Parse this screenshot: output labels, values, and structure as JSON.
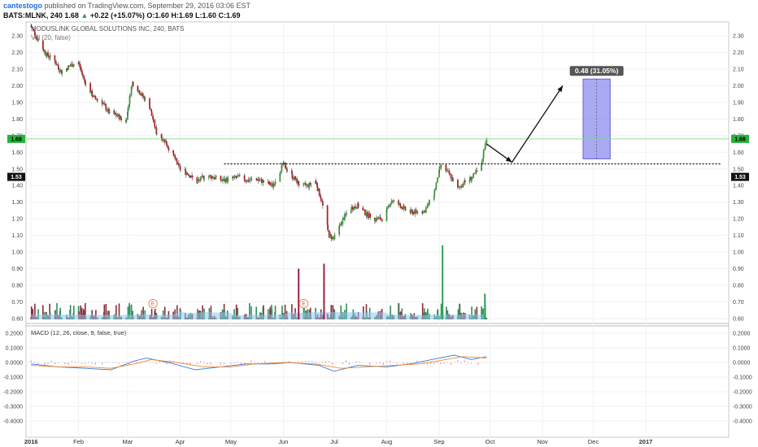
{
  "header": {
    "author": "cantestogo",
    "published": "published on TradingView.com, September 29, 2016 03:06 EST",
    "symbol": "BATS:MLNK, 240",
    "last": "1.68",
    "up_arrow": "▲",
    "change": "+0.22 (+15.07%)",
    "ohlc": "O:1.60 H:1.69 L:1.60 C:1.69"
  },
  "chart_data": [
    {
      "type": "candlestick",
      "title": "MODUSLINK GLOBAL SOLUTIONS INC, 240, BATS",
      "volume_label": "Vol (20, false)",
      "x_tick_labels": [
        "2016",
        "Feb",
        "Mar",
        "Apr",
        "May",
        "Jun",
        "Jul",
        "Aug",
        "Sep",
        "Oct",
        "Nov",
        "Dec",
        "2017"
      ],
      "y_tick_labels": [
        "2.30",
        "2.20",
        "2.10",
        "2.00",
        "1.90",
        "1.80",
        "1.70",
        "1.60",
        "1.50",
        "1.40",
        "1.30",
        "1.20",
        "1.10",
        "1.00",
        "0.90",
        "0.80",
        "0.70",
        "0.60"
      ],
      "ylim": [
        0.6,
        2.34
      ],
      "close_path": [
        [
          "2016-01-04",
          2.36
        ],
        [
          "2016-01-08",
          2.28
        ],
        [
          "2016-01-13",
          2.19
        ],
        [
          "2016-01-18",
          2.15
        ],
        [
          "2016-01-22",
          2.08
        ],
        [
          "2016-01-27",
          2.12
        ],
        [
          "2016-02-01",
          2.14
        ],
        [
          "2016-02-05",
          2.02
        ],
        [
          "2016-02-10",
          1.93
        ],
        [
          "2016-02-15",
          1.9
        ],
        [
          "2016-02-19",
          1.84
        ],
        [
          "2016-02-24",
          1.82
        ],
        [
          "2016-02-29",
          1.78
        ],
        [
          "2016-03-04",
          2.02
        ],
        [
          "2016-03-09",
          1.95
        ],
        [
          "2016-03-14",
          1.88
        ],
        [
          "2016-03-18",
          1.72
        ],
        [
          "2016-03-23",
          1.67
        ],
        [
          "2016-03-28",
          1.58
        ],
        [
          "2016-04-01",
          1.5
        ],
        [
          "2016-04-06",
          1.47
        ],
        [
          "2016-04-11",
          1.42
        ],
        [
          "2016-04-16",
          1.46
        ],
        [
          "2016-04-21",
          1.45
        ],
        [
          "2016-04-26",
          1.43
        ],
        [
          "2016-05-01",
          1.44
        ],
        [
          "2016-05-06",
          1.45
        ],
        [
          "2016-05-11",
          1.43
        ],
        [
          "2016-05-16",
          1.44
        ],
        [
          "2016-05-21",
          1.42
        ],
        [
          "2016-05-26",
          1.4
        ],
        [
          "2016-06-01",
          1.53
        ],
        [
          "2016-06-06",
          1.46
        ],
        [
          "2016-06-11",
          1.4
        ],
        [
          "2016-06-16",
          1.4
        ],
        [
          "2016-06-20",
          1.43
        ],
        [
          "2016-06-24",
          1.3
        ],
        [
          "2016-06-28",
          1.1
        ],
        [
          "2016-07-01",
          1.08
        ],
        [
          "2016-07-05",
          1.17
        ],
        [
          "2016-07-10",
          1.26
        ],
        [
          "2016-07-15",
          1.28
        ],
        [
          "2016-07-20",
          1.23
        ],
        [
          "2016-07-25",
          1.2
        ],
        [
          "2016-07-30",
          1.2
        ],
        [
          "2016-08-04",
          1.31
        ],
        [
          "2016-08-09",
          1.28
        ],
        [
          "2016-08-14",
          1.24
        ],
        [
          "2016-08-19",
          1.24
        ],
        [
          "2016-08-24",
          1.25
        ],
        [
          "2016-08-29",
          1.35
        ],
        [
          "2016-09-02",
          1.52
        ],
        [
          "2016-09-07",
          1.47
        ],
        [
          "2016-09-12",
          1.38
        ],
        [
          "2016-09-16",
          1.42
        ],
        [
          "2016-09-21",
          1.45
        ],
        [
          "2016-09-26",
          1.52
        ],
        [
          "2016-09-29",
          1.69
        ]
      ],
      "volume_spikes": [
        [
          "2016-06-25",
          0.93
        ],
        [
          "2016-06-10",
          0.9
        ],
        [
          "2016-09-03",
          1.04
        ],
        [
          "2016-09-28",
          0.75
        ]
      ],
      "events": [
        {
          "date": "2016-03-16",
          "label": "E"
        },
        {
          "date": "2016-06-13",
          "label": "E"
        }
      ],
      "last_price": "1.68",
      "resistance": "1.53",
      "projection_label": "0.48 (31.05%)",
      "annotations": [
        {
          "kind": "resistance-line",
          "y": 1.53,
          "from": "2016-04-27",
          "to": "2017-02-15"
        },
        {
          "kind": "arrow",
          "path": [
            [
              "2016-09-29",
              1.65
            ],
            [
              "2016-10-14",
              1.54
            ],
            [
              "2016-11-13",
              2.0
            ]
          ]
        },
        {
          "kind": "price-range",
          "from": "2016-11-25",
          "to": "2016-12-11",
          "low": 1.56,
          "high": 2.04
        }
      ]
    },
    {
      "type": "line",
      "title": "MACD (12, 26, close, 9, false, true)",
      "y_tick_labels": [
        "0.2000",
        "0.1000",
        "0.0000",
        "-0.1000",
        "-0.2000",
        "-0.3000",
        "-0.4000"
      ],
      "ylim": [
        -0.435,
        0.24
      ],
      "series": [
        {
          "values": [
            [
              "2016-01-04",
              -0.01
            ],
            [
              "2016-01-20",
              -0.03
            ],
            [
              "2016-02-05",
              -0.04
            ],
            [
              "2016-02-20",
              -0.05
            ],
            [
              "2016-03-05",
              0.01
            ],
            [
              "2016-03-12",
              0.03
            ],
            [
              "2016-03-25",
              0.0
            ],
            [
              "2016-04-10",
              -0.05
            ],
            [
              "2016-04-25",
              -0.03
            ],
            [
              "2016-05-10",
              -0.01
            ],
            [
              "2016-05-25",
              -0.01
            ],
            [
              "2016-06-05",
              0.0
            ],
            [
              "2016-06-22",
              -0.02
            ],
            [
              "2016-07-01",
              -0.06
            ],
            [
              "2016-07-15",
              -0.02
            ],
            [
              "2016-08-01",
              -0.03
            ],
            [
              "2016-08-15",
              -0.01
            ],
            [
              "2016-09-01",
              0.03
            ],
            [
              "2016-09-10",
              0.05
            ],
            [
              "2016-09-20",
              0.02
            ],
            [
              "2016-09-29",
              0.04
            ]
          ]
        },
        {
          "values": [
            [
              "2016-01-04",
              -0.02
            ],
            [
              "2016-01-20",
              -0.03
            ],
            [
              "2016-02-05",
              -0.03
            ],
            [
              "2016-02-20",
              -0.04
            ],
            [
              "2016-03-05",
              -0.01
            ],
            [
              "2016-03-15",
              0.02
            ],
            [
              "2016-03-30",
              0.0
            ],
            [
              "2016-04-15",
              -0.03
            ],
            [
              "2016-05-01",
              -0.03
            ],
            [
              "2016-05-15",
              -0.01
            ],
            [
              "2016-06-01",
              0.0
            ],
            [
              "2016-06-20",
              -0.01
            ],
            [
              "2016-07-05",
              -0.04
            ],
            [
              "2016-07-20",
              -0.03
            ],
            [
              "2016-08-05",
              -0.02
            ],
            [
              "2016-08-20",
              -0.01
            ],
            [
              "2016-09-05",
              0.02
            ],
            [
              "2016-09-15",
              0.04
            ],
            [
              "2016-09-29",
              0.03
            ]
          ]
        }
      ]
    }
  ]
}
